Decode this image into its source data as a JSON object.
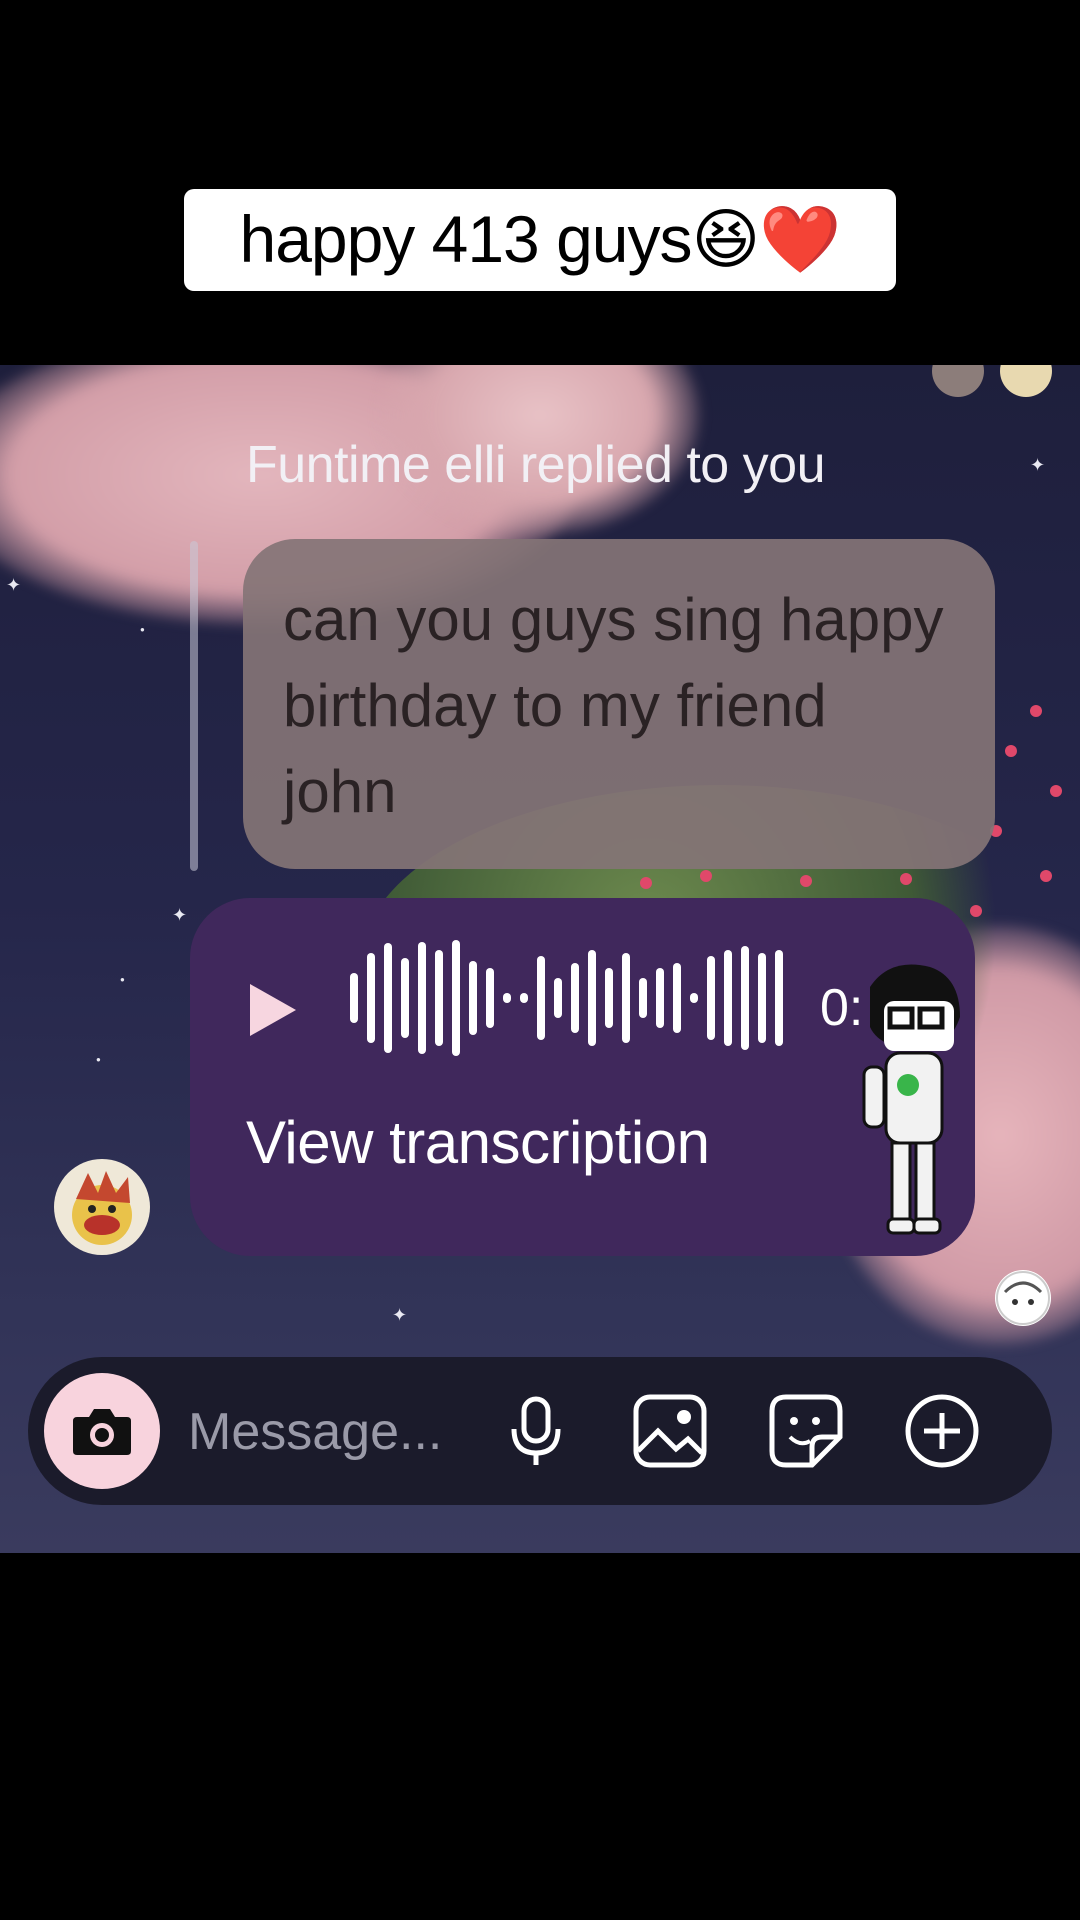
{
  "caption": {
    "text": "happy 413 guys😆❤️"
  },
  "chat": {
    "reply_label": "Funtime elli replied to you",
    "quoted_message": "can you guys sing happy birthday to my friend john",
    "voice_message": {
      "duration_visible": "0:",
      "view_transcription": "View transcription"
    }
  },
  "composer": {
    "placeholder": "Message..."
  },
  "icons": [
    "camera-icon",
    "microphone-icon",
    "gallery-icon",
    "sticker-icon",
    "plus-icon",
    "play-icon"
  ],
  "colors": {
    "voice_bubble": "#40285c",
    "quoted_bubble": "#847476",
    "camera_button": "#f8d3dd",
    "composer": "#1b1b2b"
  }
}
